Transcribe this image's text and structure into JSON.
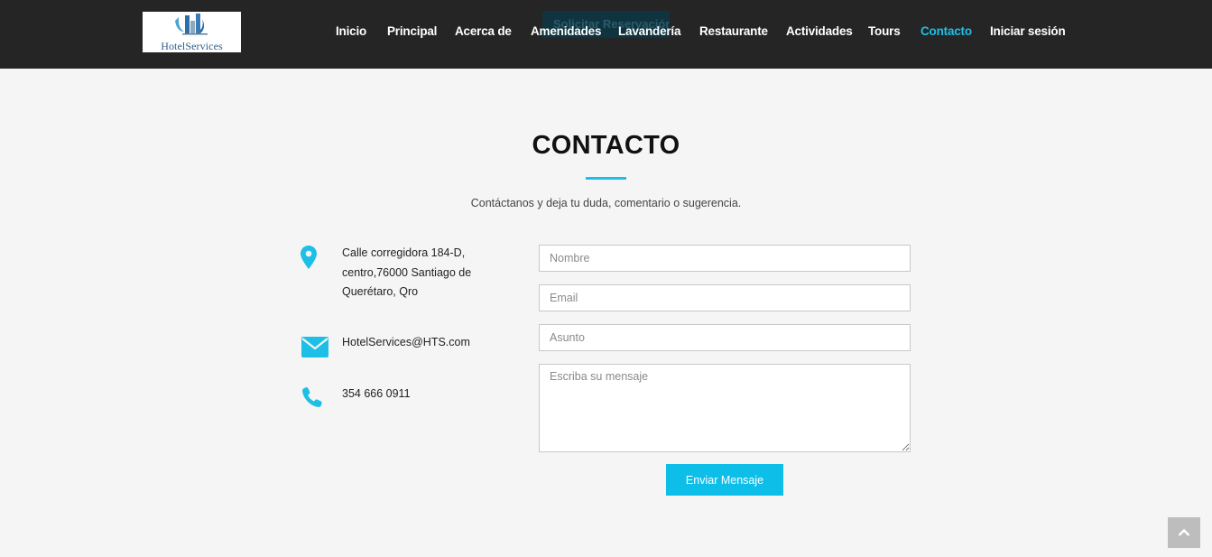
{
  "header": {
    "logo_text": "HotelServices",
    "hidden_button_label": "Solicitar Reservación",
    "nav": [
      {
        "label": "Inicio",
        "active": false
      },
      {
        "label": "Principal",
        "active": false
      },
      {
        "label": "Acerca de",
        "active": false
      },
      {
        "label": "Amenidades",
        "active": false
      },
      {
        "label": "Lavandería",
        "active": false
      },
      {
        "label": "Restaurante",
        "active": false
      },
      {
        "label": "Actividades",
        "active": false
      },
      {
        "label": "Tours",
        "active": false
      },
      {
        "label": "Contacto",
        "active": true
      },
      {
        "label": "Iniciar sesión",
        "active": false
      }
    ]
  },
  "section": {
    "title": "CONTACTO",
    "subtitle": "Contáctanos y deja tu duda, comentario o sugerencia."
  },
  "contact_info": {
    "address_line1": "Calle corregidora 184-D,",
    "address_line2": "centro,76000 Santiago de",
    "address_line3": "Querétaro, Qro",
    "email": "HotelServices@HTS.com",
    "phone": "354 666 0911"
  },
  "form": {
    "name_placeholder": "Nombre",
    "email_placeholder": "Email",
    "subject_placeholder": "Asunto",
    "message_placeholder": "Escriba su mensaje",
    "submit_label": "Enviar Mensaje"
  },
  "icons": {
    "address": "map-pin-icon",
    "email": "envelope-icon",
    "phone": "phone-icon",
    "scroll_top": "chevron-up-icon"
  },
  "colors": {
    "accent": "#1ebfe6",
    "header_bg": "#252525",
    "page_bg": "#f5f5f5",
    "button_bg": "#0dbfe8"
  }
}
